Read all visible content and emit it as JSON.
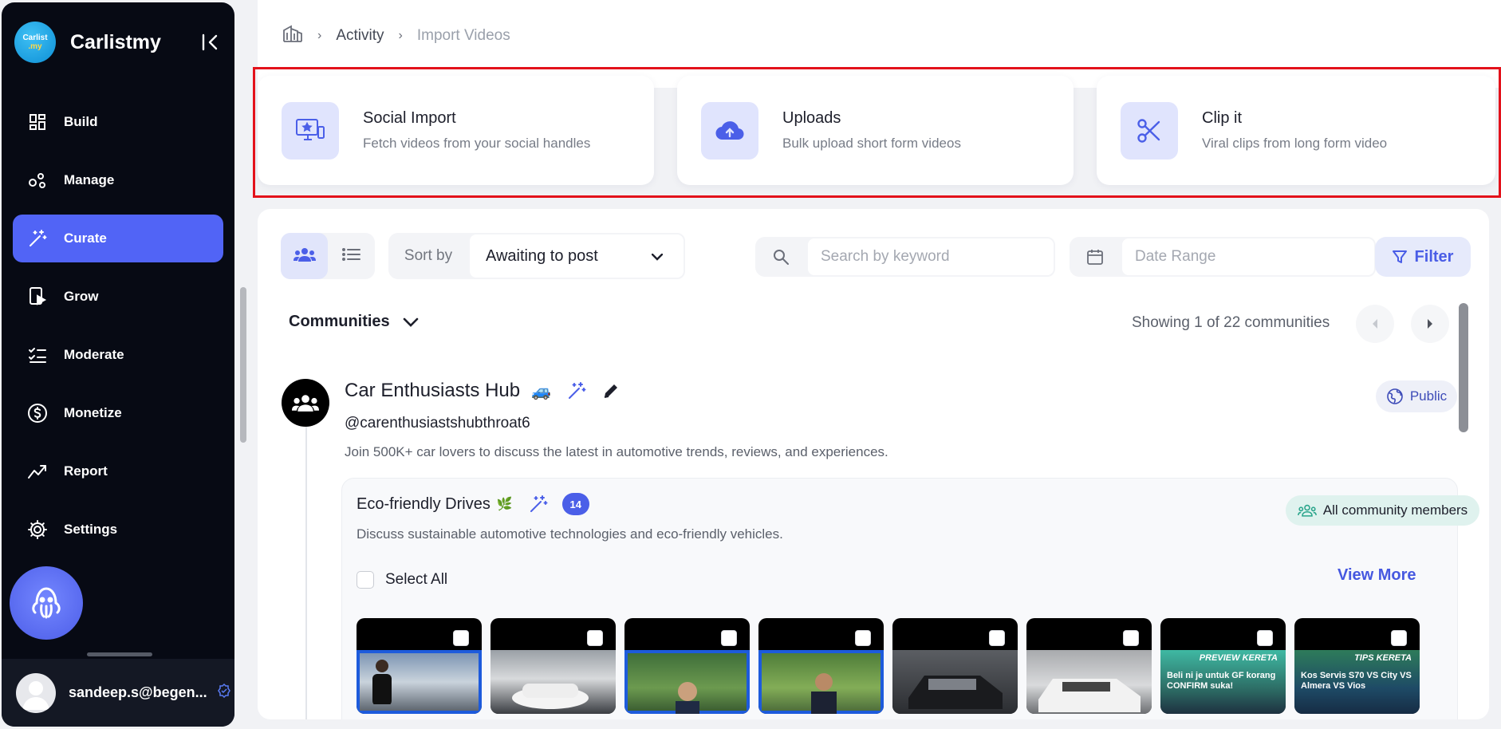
{
  "app": {
    "name": "Carlistmy",
    "logo_top": "Carlist",
    "logo_bottom": ".my"
  },
  "sidebar": {
    "items": [
      {
        "label": "Build",
        "icon": "layout-grid-icon"
      },
      {
        "label": "Manage",
        "icon": "nodes-icon"
      },
      {
        "label": "Curate",
        "icon": "magic-wand-icon",
        "active": true
      },
      {
        "label": "Grow",
        "icon": "play-screen-icon"
      },
      {
        "label": "Moderate",
        "icon": "checklist-icon"
      },
      {
        "label": "Monetize",
        "icon": "dollar-circle-icon"
      },
      {
        "label": "Report",
        "icon": "trend-chart-icon"
      },
      {
        "label": "Settings",
        "icon": "gear-icon"
      }
    ],
    "user_email": "sandeep.s@begen..."
  },
  "breadcrumb": {
    "home_icon": "building-icon",
    "items": [
      "Activity",
      "Import Videos"
    ]
  },
  "import_cards": [
    {
      "title": "Social Import",
      "subtitle": "Fetch videos from your social handles",
      "icon": "monitor-star-icon"
    },
    {
      "title": "Uploads",
      "subtitle": "Bulk upload short form videos",
      "icon": "cloud-upload-icon"
    },
    {
      "title": "Clip it",
      "subtitle": "Viral clips from long form video",
      "icon": "scissors-icon"
    }
  ],
  "toolbar": {
    "sort_label": "Sort by",
    "sort_value": "Awaiting to post",
    "search_placeholder": "Search by keyword",
    "date_placeholder": "Date Range",
    "filter_label": "Filter"
  },
  "communities": {
    "dropdown_label": "Communities",
    "showing_text": "Showing 1 of 22 communities"
  },
  "community": {
    "name": "Car Enthusiasts Hub",
    "emoji": "🚙",
    "handle": "@carenthusiastshubthroat6",
    "description": "Join 500K+ car lovers to discuss the latest in automotive trends, reviews, and experiences.",
    "visibility": "Public"
  },
  "sub_community": {
    "name": "Eco-friendly Drives",
    "emoji": "🌿",
    "count": "14",
    "description": "Discuss sustainable automotive technologies and eco-friendly vehicles.",
    "audience": "All community members",
    "select_all": "Select All",
    "view_more": "View More",
    "thumbnails": [
      {
        "label": "",
        "caption": ""
      },
      {
        "label": "",
        "caption": ""
      },
      {
        "label": "",
        "caption": ""
      },
      {
        "label": "",
        "caption": ""
      },
      {
        "label": "",
        "caption": ""
      },
      {
        "label": "",
        "caption": ""
      },
      {
        "label": "PREVIEW KERETA",
        "caption": "Beli ni je untuk GF korang CONFIRM suka!"
      },
      {
        "label": "TIPS KERETA",
        "caption": "Kos Servis S70 VS City VS Almera VS Vios"
      }
    ]
  },
  "colors": {
    "accent": "#5164f6",
    "highlight": "#e3121b",
    "sidebar_bg": "#070a14"
  }
}
